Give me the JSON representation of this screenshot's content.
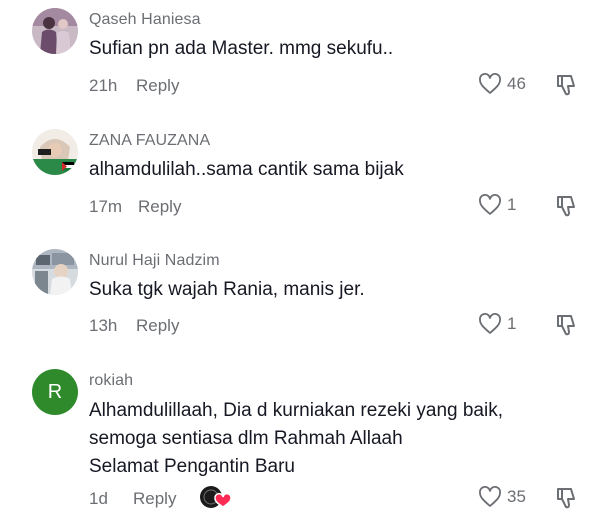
{
  "comments": [
    {
      "username": "Qaseh Haniesa",
      "text": "Sufian pn ada Master. mmg sekufu..",
      "time": "21h",
      "reply_label": "Reply",
      "likes": "46",
      "avatar": "photo"
    },
    {
      "username": "ZANA FAUZANA",
      "text": "alhamdulilah..sama cantik sama bijak",
      "time": "17m",
      "reply_label": "Reply",
      "likes": "1",
      "avatar": "photo"
    },
    {
      "username": "Nurul Haji Nadzim",
      "text": "Suka tgk wajah Rania, manis jer.",
      "time": "13h",
      "reply_label": "Reply",
      "likes": "1",
      "avatar": "photo"
    },
    {
      "username": "rokiah",
      "avatar_letter": "R",
      "text_lines": [
        "Alhamdulillaah, Dia d kurniakan rezeki yang baik,",
        "semoga sentiasa dlm Rahmah Allaah",
        "Selamat Pengantin Baru"
      ],
      "time": "1d",
      "reply_label": "Reply",
      "likes": "35",
      "liked_by_creator": true
    }
  ],
  "colors": {
    "primary_text": "#161823",
    "secondary_text": "#6b6e73",
    "avatar_green": "#2f8a2c",
    "creator_heart": "#fe2c55"
  },
  "icons": [
    "heart-outline-icon",
    "dislike-icon",
    "creator-liked-badge"
  ]
}
